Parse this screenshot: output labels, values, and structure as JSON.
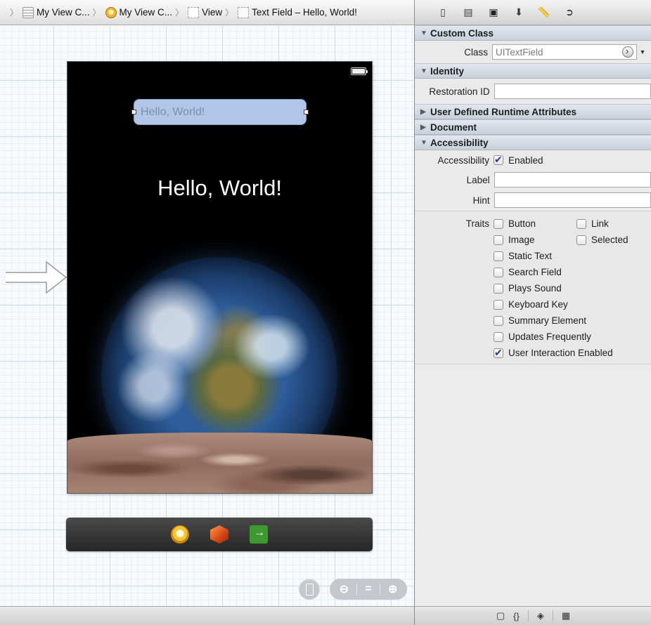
{
  "breadcrumb": [
    {
      "label": "My View C...",
      "icon": "storyboard-icon"
    },
    {
      "label": "My View C...",
      "icon": "view-controller-icon"
    },
    {
      "label": "View",
      "icon": "view-icon"
    },
    {
      "label": "Text Field – Hello, World!",
      "icon": "text-field-icon"
    }
  ],
  "canvas": {
    "text_field_placeholder": "Hello, World!",
    "label_text": "Hello, World!"
  },
  "inspector": {
    "tabs": [
      "file-inspector-icon",
      "quick-help-icon",
      "identity-inspector-icon",
      "attributes-inspector-icon",
      "size-inspector-icon",
      "connections-inspector-icon"
    ],
    "sections": {
      "custom_class": "Custom Class",
      "identity": "Identity",
      "user_defined": "User Defined Runtime Attributes",
      "document": "Document",
      "accessibility": "Accessibility"
    },
    "class_label": "Class",
    "class_placeholder": "UITextField",
    "restoration_label": "Restoration ID",
    "restoration_value": "",
    "accessibility_label": "Accessibility",
    "accessibility_enabled": "Enabled",
    "label_label": "Label",
    "label_value": "",
    "hint_label": "Hint",
    "hint_value": "",
    "traits_label": "Traits",
    "traits_left": [
      {
        "label": "Button",
        "checked": false
      },
      {
        "label": "Image",
        "checked": false
      },
      {
        "label": "Static Text",
        "checked": false
      },
      {
        "label": "Search Field",
        "checked": false
      },
      {
        "label": "Plays Sound",
        "checked": false
      },
      {
        "label": "Keyboard Key",
        "checked": false
      },
      {
        "label": "Summary Element",
        "checked": false
      },
      {
        "label": "Updates Frequently",
        "checked": false
      },
      {
        "label": "User Interaction Enabled",
        "checked": true
      }
    ],
    "traits_right": [
      {
        "label": "Link",
        "checked": false
      },
      {
        "label": "Selected",
        "checked": false
      }
    ]
  },
  "library_bar": {
    "icons": [
      "file-template-icon",
      "code-snippet-icon",
      "object-library-icon",
      "media-library-icon"
    ],
    "glyphs": [
      "▢",
      "{}",
      "◈",
      "▦"
    ]
  },
  "colors": {
    "section_header": "#c9d0db",
    "canvas_grid": "#cbdbe8",
    "text_field_bg": "#b1c7e8",
    "checkbox_check": "#1f3a8a"
  }
}
